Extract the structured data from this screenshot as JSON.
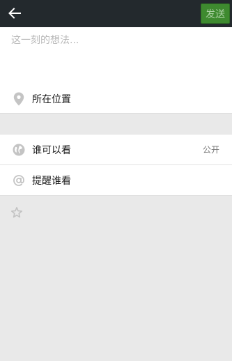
{
  "topbar": {
    "back_icon": "arrow-left-icon",
    "send_label": "发送"
  },
  "compose": {
    "placeholder": "这一刻的想法..."
  },
  "location": {
    "icon": "location-pin-icon",
    "label": "所在位置"
  },
  "visibility": {
    "icon": "globe-icon",
    "label": "谁可以看",
    "value": "公开"
  },
  "remind": {
    "icon": "at-icon",
    "label": "提醒谁看"
  },
  "extra": {
    "icon": "star-icon"
  },
  "colors": {
    "topbar_bg": "#23292d",
    "send_button": "#3e8a2f",
    "background": "#e9e9e9"
  }
}
